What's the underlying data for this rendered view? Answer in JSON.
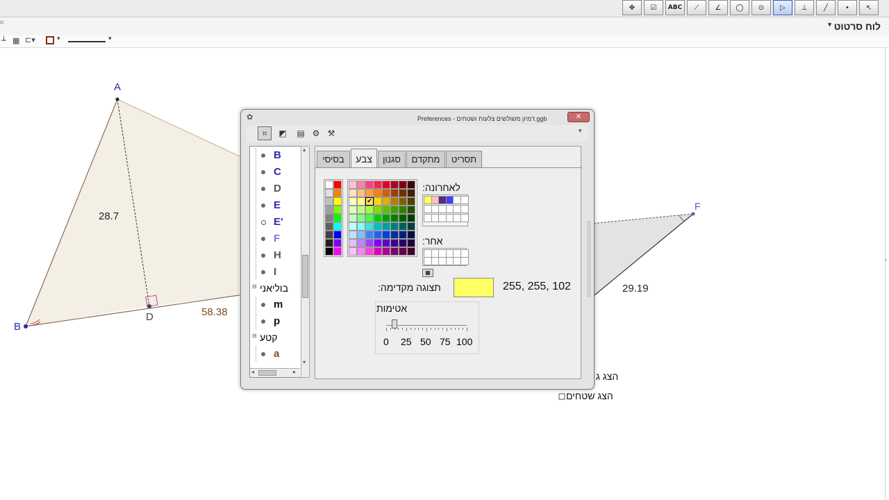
{
  "toolbar": {
    "tools": [
      "move",
      "checkbox",
      "text",
      "slope",
      "angle",
      "circle",
      "circle-center",
      "polygon",
      "perpendicular",
      "line",
      "point",
      "pointer"
    ],
    "text_tool_label": "ABC"
  },
  "graphics_view": {
    "title": "לוח סרטוט"
  },
  "canvas": {
    "points": [
      "A",
      "B",
      "D",
      "F"
    ],
    "measurements": [
      "28.7",
      "58.38",
      "29.19"
    ],
    "checkbox_labels": [
      "הצג גובה",
      "הצג שטחים"
    ],
    "partial_checkbox_label": "הצג ג"
  },
  "dialog": {
    "title": "Preferences - דמיון משולשים צלעות ושטחים.ggb",
    "tree": {
      "items": [
        {
          "name": "B",
          "type": "point",
          "color": "#2a2aa8",
          "hollow": false
        },
        {
          "name": "C",
          "type": "point",
          "color": "#2a2aa8",
          "hollow": false
        },
        {
          "name": "D",
          "type": "point",
          "color": "#555555",
          "hollow": false
        },
        {
          "name": "E",
          "type": "point",
          "color": "#2a2aa8",
          "hollow": false
        },
        {
          "name": "E'",
          "type": "point",
          "color": "#2a2aa8",
          "hollow": true
        },
        {
          "name": "F",
          "type": "point",
          "color": "#5a5ab8",
          "hollow": false
        },
        {
          "name": "H",
          "type": "point",
          "color": "#555555",
          "hollow": false
        },
        {
          "name": "I",
          "type": "point",
          "color": "#555555",
          "hollow": false
        }
      ],
      "group_boolean": "בוליאני",
      "boolean_items": [
        "m",
        "p"
      ],
      "group_segment": "קטע",
      "segment_items": [
        "a"
      ]
    },
    "tabs": [
      "בסיסי",
      "צבע",
      "סגנון",
      "מתקדם",
      "תסריט"
    ],
    "active_tab": "צבע",
    "recent_label": "לאחרונה:",
    "other_label": "אחר:",
    "preview_label": "תצוגה מקדימה:",
    "rgb_value": "255, 255, 102",
    "preview_color": "#ffff66",
    "opacity_label": "אטימות",
    "opacity_ticks": [
      "0",
      "25",
      "50",
      "75",
      "100"
    ],
    "opacity_value": 0.1
  }
}
